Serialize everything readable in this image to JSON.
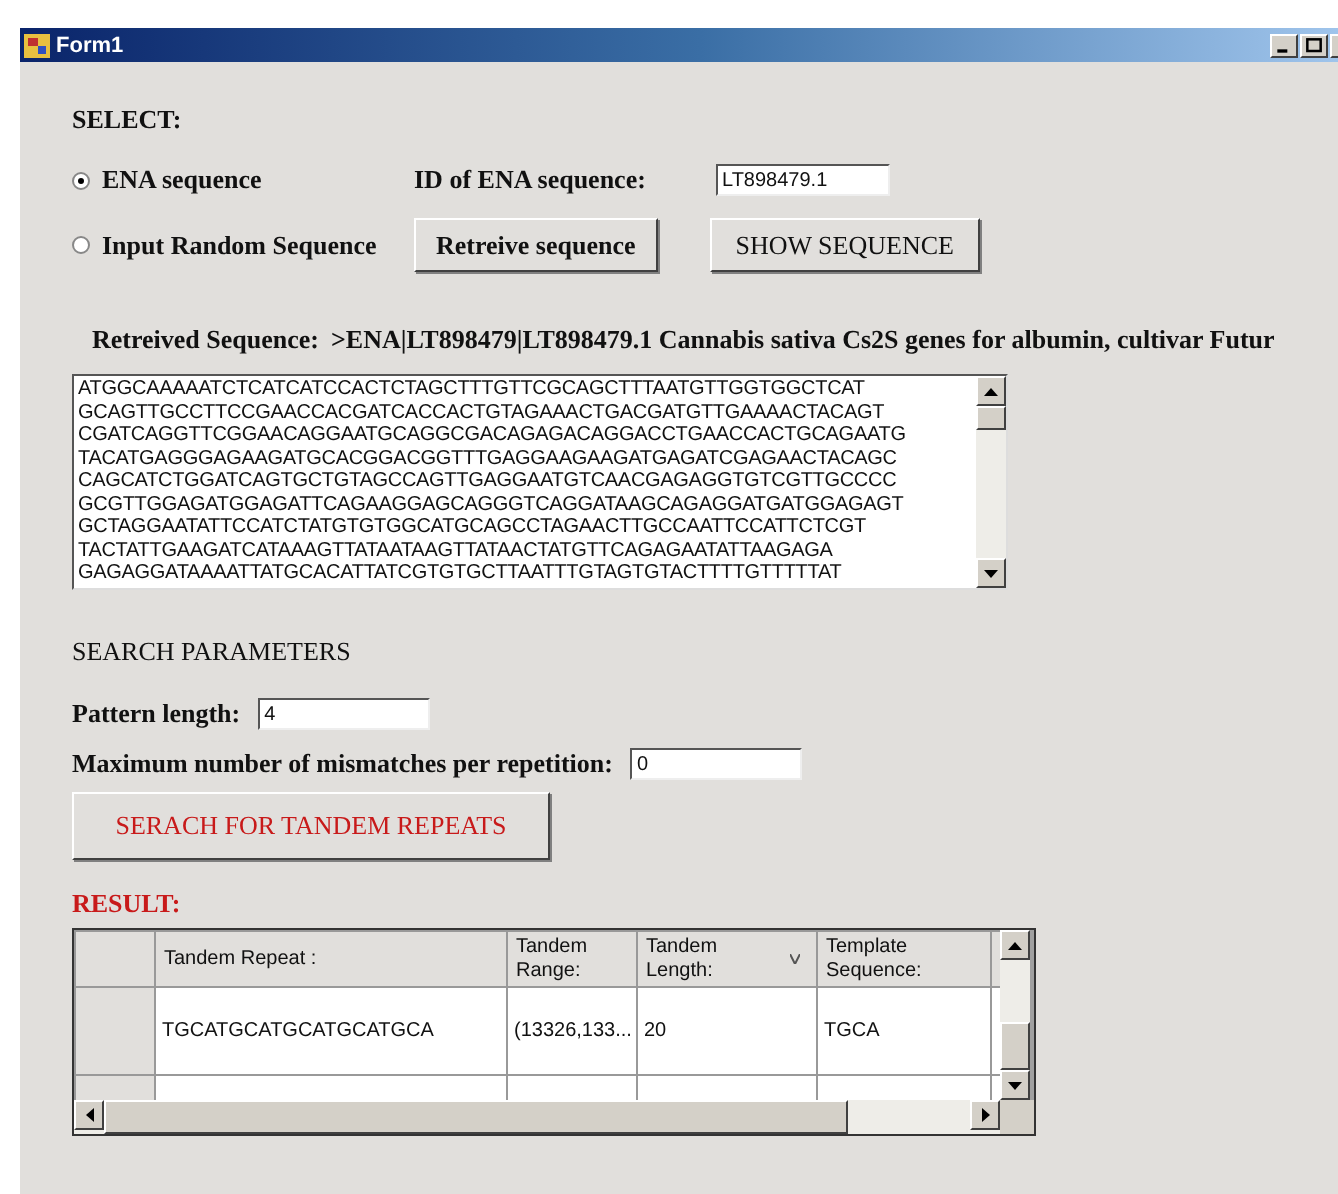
{
  "window": {
    "title": "Form1"
  },
  "select": {
    "heading": "SELECT:",
    "options": [
      {
        "label": "ENA sequence",
        "selected": true
      },
      {
        "label": "Input Random Sequence",
        "selected": false
      }
    ],
    "id_label": "ID of ENA sequence:",
    "id_value": "LT898479.1",
    "retrieve_button": "Retreive sequence",
    "show_button": "SHOW SEQUENCE"
  },
  "retrieved": {
    "label": "Retreived Sequence:",
    "value": ">ENA|LT898479|LT898479.1 Cannabis sativa Cs2S genes for albumin, cultivar Futur",
    "lines": [
      "ATGGCAAAAATCTCATCATCCACTCTAGCTTTGTTCGCAGCTTTAATGTTGGTGGCTCAT",
      "GCAGTTGCCTTCCGAACCACGATCACCACTGTAGAAACTGACGATGTTGAAAACTACAGT",
      "CGATCAGGTTCGGAACAGGAATGCAGGCGACAGAGACAGGACCTGAACCACTGCAGAATG",
      "TACATGAGGGAGAAGATGCACGGACGGTTTGAGGAAGAAGATGAGATCGAGAACTACAGC",
      "CAGCATCTGGATCAGTGCTGTAGCCAGTTGAGGAATGTCAACGAGAGGTGTCGTTGCCCC",
      "GCGTTGGAGATGGAGATTCAGAAGGAGCAGGGTCAGGATAAGCAGAGGATGATGGAGAGT",
      "GCTAGGAATATTCCATCTATGTGTGGCATGCAGCCTAGAACTTGCCAATTCCATTCTCGT",
      "TACTATTGAAGATCATAAAGTTATAATAAGTTATAACTATGTTCAGAGAATATTAAGAGA",
      "GAGAGGATAAAATTATGCACATTATCGTGTGCTTAATTTGTAGTGTACTTTTGTTTTTAT"
    ]
  },
  "search": {
    "heading": "SEARCH PARAMETERS",
    "pattern_label": "Pattern length:",
    "pattern_value": "4",
    "mismatch_label": "Maximum number of mismatches per repetition:",
    "mismatch_value": "0",
    "button": "SERACH FOR TANDEM REPEATS"
  },
  "result": {
    "heading": "RESULT:",
    "columns": [
      "Tandem Repeat :",
      "Tandem Range:",
      "Tandem Length:",
      "Template Sequence:"
    ],
    "rows": [
      {
        "cells": [
          "TGCATGCATGCATGCATGCA",
          "(13326,133...",
          "20",
          "TGCA"
        ]
      }
    ]
  }
}
